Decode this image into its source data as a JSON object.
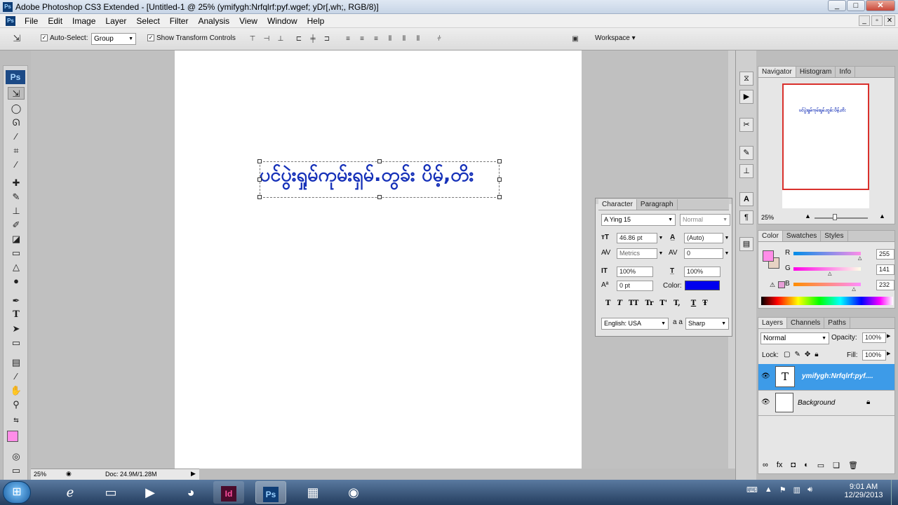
{
  "window": {
    "title": "Adobe Photoshop CS3 Extended - [Untitled-1 @ 25% (ymifygh:Nrfqlrf:pyf.wgef; yDr[,wh;, RGB/8)]",
    "controls": [
      "_",
      "□",
      "✕"
    ],
    "app_icon": "Ps"
  },
  "menu": [
    "File",
    "Edit",
    "Image",
    "Layer",
    "Select",
    "Filter",
    "Analysis",
    "View",
    "Window",
    "Help"
  ],
  "mdi_controls": [
    "_",
    "▫",
    "✕"
  ],
  "options": {
    "auto_select_label": "Auto-Select:",
    "auto_select_value": "Group",
    "show_transform_label": "Show Transform Controls",
    "workspace_label": "Workspace ▾"
  },
  "toolbox": {
    "logo": "Ps"
  },
  "document": {
    "text": "ပင်ပွဲးရှုမ်ကုမ်းရှမ်.တွခ်း ပိမ့်,တိး",
    "zoom": "25%",
    "doc_info": "Doc: 24.9M/1.28M"
  },
  "navigator": {
    "tabs": [
      "Navigator",
      "Histogram",
      "Info"
    ],
    "zoom": "25%",
    "thumb_text": "ပင်ပွဲးရှုမ်ကုမ်းရှမ်.တွခ်း ပိမ့်,တိး"
  },
  "color": {
    "tabs": [
      "Color",
      "Swatches",
      "Styles"
    ],
    "r_label": "R",
    "g_label": "G",
    "b_label": "B",
    "r": "255",
    "g": "141",
    "b": "232",
    "r_frac": 1.0,
    "g_frac": 0.553,
    "b_frac": 0.91,
    "fg": "#ff8de8",
    "bg": "#e7d3c4"
  },
  "layers": {
    "tabs": [
      "Layers",
      "Channels",
      "Paths"
    ],
    "blend_mode": "Normal",
    "opacity_label": "Opacity:",
    "opacity": "100%",
    "lock_label": "Lock:",
    "fill_label": "Fill:",
    "fill": "100%",
    "items": [
      {
        "name": "ymifygh:Nrfqlrf:pyf....",
        "thumb": "T",
        "selected": true
      },
      {
        "name": "Background",
        "thumb": "",
        "selected": false
      }
    ]
  },
  "character": {
    "tabs": [
      "Character",
      "Paragraph"
    ],
    "font": "A Ying 15",
    "style": "Normal",
    "size": "46.86 pt",
    "leading": "(Auto)",
    "kerning": "Metrics",
    "tracking": "0",
    "vscale": "100%",
    "hscale": "100%",
    "baseline": "0 pt",
    "color_label": "Color:",
    "text_color": "#0000ee",
    "styles": [
      "T",
      "T",
      "TT",
      "Tr",
      "T'",
      "T,",
      "T",
      "Ŧ"
    ],
    "language": "English: USA",
    "aa_label": "a a",
    "antialias": "Sharp"
  },
  "taskbar": {
    "time": "9:01 AM",
    "date": "12/29/2013",
    "apps": [
      "ie-icon",
      "folder-icon",
      "media-icon",
      "firefox-icon",
      "indesign-icon",
      "photoshop-icon",
      "picture-icon",
      "chrome-icon"
    ],
    "id_label": "Id",
    "ps_label": "Ps"
  },
  "colors": {
    "text_blue": "#1530b8",
    "selected_layer": "#3d9be8",
    "nav_frame": "#d9302c"
  }
}
